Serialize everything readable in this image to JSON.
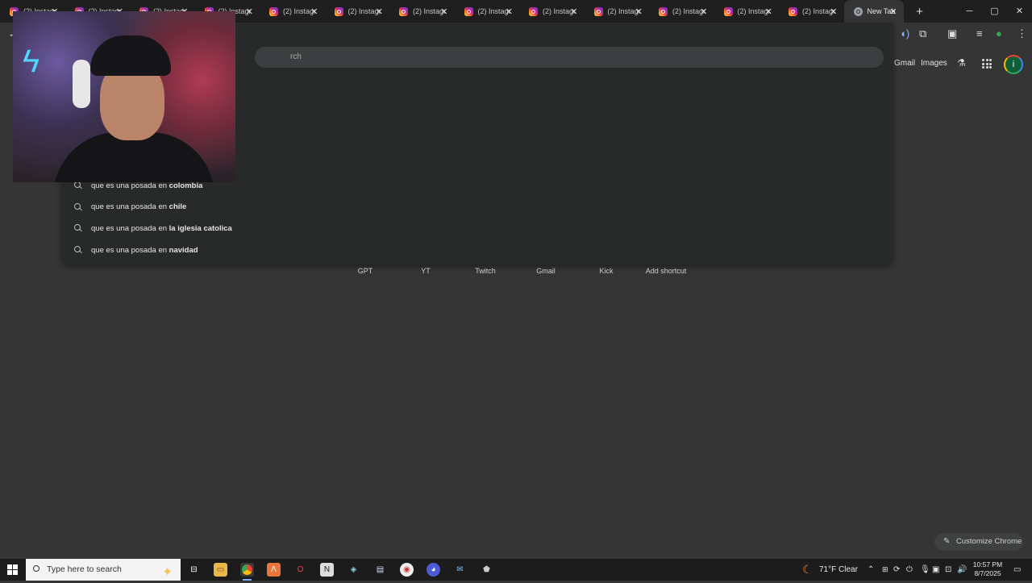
{
  "browser": {
    "tabs": [
      {
        "title": "(2) Instagram",
        "active": false
      },
      {
        "title": "(2) Instagram",
        "active": false
      },
      {
        "title": "(2) Instagram",
        "active": false
      },
      {
        "title": "(2) Instagram",
        "active": false
      },
      {
        "title": "(2) Instagram",
        "active": false
      },
      {
        "title": "(2) Instagram",
        "active": false
      },
      {
        "title": "(2) Instagram",
        "active": false
      },
      {
        "title": "(2) Instagram",
        "active": false
      },
      {
        "title": "(2) Instagram",
        "active": false
      },
      {
        "title": "(2) Instagram",
        "active": false
      },
      {
        "title": "(2) Instagram",
        "active": false
      },
      {
        "title": "(2) Instagram",
        "active": false
      },
      {
        "title": "(2) Instagram",
        "active": false
      },
      {
        "title": "New Tab",
        "active": true
      }
    ],
    "new_tab_symbol": "+",
    "window_controls": {
      "minimize": "─",
      "maximize": "▢",
      "close": "✕"
    }
  },
  "omnibox": {
    "placeholder": "rch",
    "suggestions": [
      {
        "prefix": "que es una posada en ",
        "bold": "colombia"
      },
      {
        "prefix": "que es una posada en ",
        "bold": "chile"
      },
      {
        "prefix": "que es una posada en ",
        "bold": "la iglesia catolica"
      },
      {
        "prefix": "que es una posada en ",
        "bold": "navidad"
      }
    ]
  },
  "header": {
    "gmail": "Gmail",
    "images": "Images",
    "avatar_letter": "i"
  },
  "shortcuts": [
    "GPT",
    "YT",
    "Twitch",
    "Gmail",
    "Kick",
    "Add shortcut"
  ],
  "customize_label": "Customize Chrome",
  "taskbar": {
    "search_placeholder": "Type here to search",
    "weather": "71°F  Clear",
    "time": "10:57 PM",
    "date": "8/7/2025"
  }
}
